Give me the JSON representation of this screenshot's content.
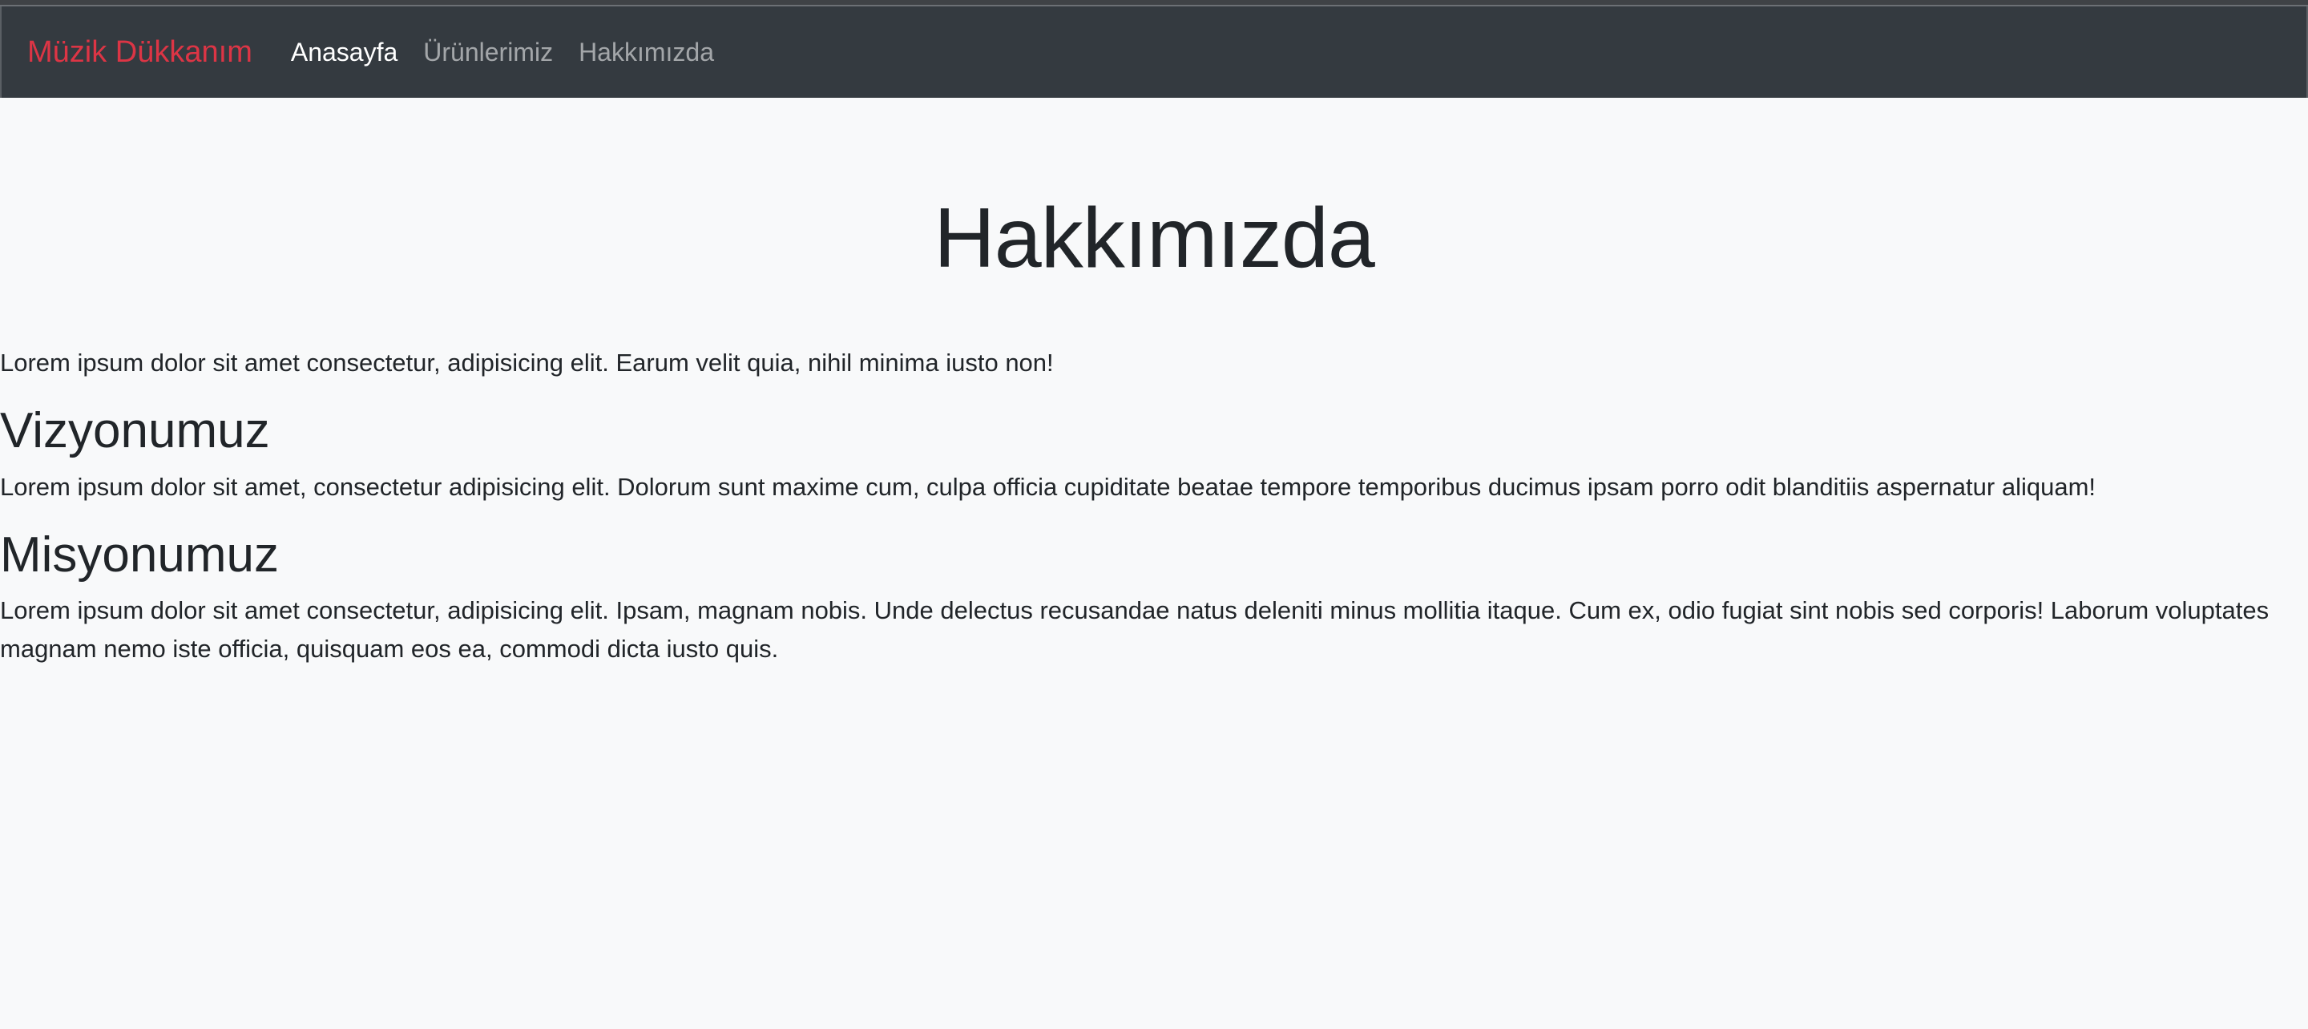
{
  "navbar": {
    "brand": "Müzik Dükkanım",
    "links": [
      {
        "label": "Anasayfa",
        "active": true
      },
      {
        "label": "Ürünlerimiz",
        "active": false
      },
      {
        "label": "Hakkımızda",
        "active": false
      }
    ]
  },
  "main": {
    "title": "Hakkımızda",
    "intro": "Lorem ipsum dolor sit amet consectetur, adipisicing elit. Earum velit quia, nihil minima iusto non!",
    "sections": [
      {
        "heading": "Vizyonumuz",
        "text": "Lorem ipsum dolor sit amet, consectetur adipisicing elit. Dolorum sunt maxime cum, culpa officia cupiditate beatae tempore temporibus ducimus ipsam porro odit blanditiis aspernatur aliquam!"
      },
      {
        "heading": "Misyonumuz",
        "text": "Lorem ipsum dolor sit amet consectetur, adipisicing elit. Ipsam, magnam nobis. Unde delectus recusandae natus deleniti minus mollitia itaque. Cum ex, odio fugiat sint nobis sed corporis! Laborum voluptates magnam nemo iste officia, quisquam eos ea, commodi dicta iusto quis."
      }
    ]
  },
  "colors": {
    "navbar_bg": "#343a40",
    "brand": "#dc3545",
    "page_bg": "#f8f9fa",
    "text": "#212529"
  }
}
